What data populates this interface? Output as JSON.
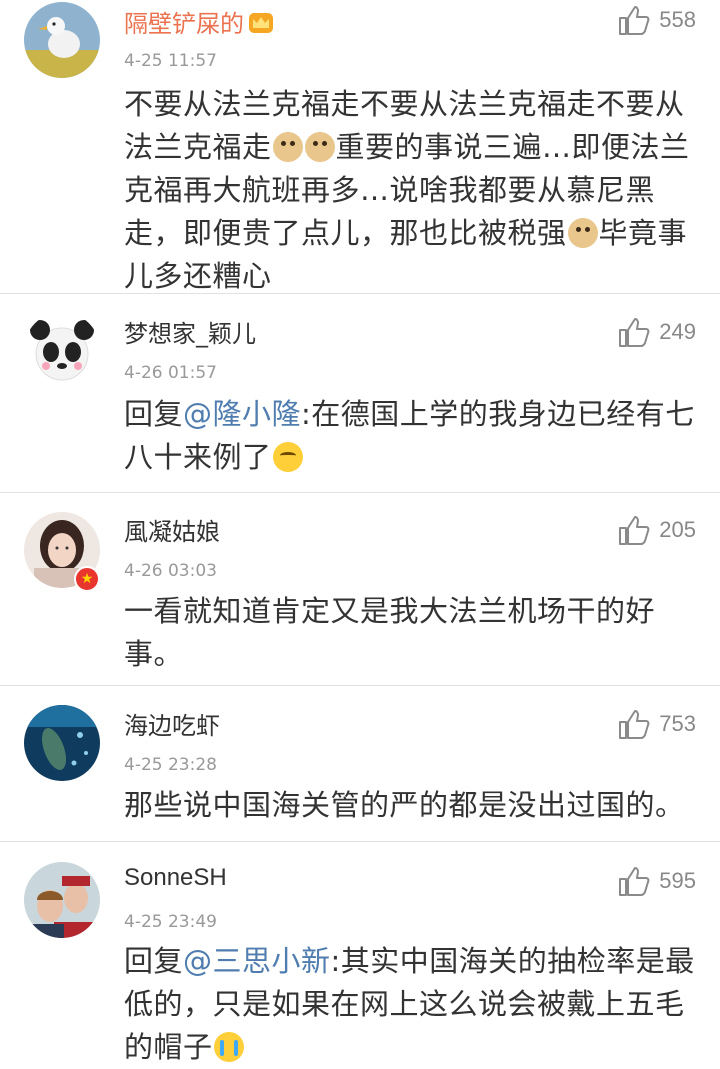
{
  "comments": [
    {
      "name": "隔壁铲屎的",
      "time": "4-25 11:57",
      "likes": "558",
      "text_parts": [
        "不要从法兰克福走不要从法兰克福走不要从法兰克福走",
        "重要的事说三遍…即便法兰克福再大航班再多…说啥我都要从慕尼黑走，即便贵了点儿，那也比被税强",
        "毕竟事儿多还糟心"
      ]
    },
    {
      "name": "梦想家_颖儿",
      "time": "4-26 01:57",
      "likes": "249",
      "reply_prefix": "回复",
      "mention": "@隆小隆",
      "text": ":在德国上学的我身边已经有七八十来例了"
    },
    {
      "name": "風凝姑娘",
      "time": "4-26 03:03",
      "likes": "205",
      "text": "一看就知道肯定又是我大法兰机场干的好事。"
    },
    {
      "name": "海边吃虾",
      "time": "4-25 23:28",
      "likes": "753",
      "text": "那些说中国海关管的严的都是没出过国的。"
    },
    {
      "name": "SonneSH",
      "time": "4-25 23:49",
      "likes": "595",
      "reply_prefix": "回复",
      "mention": "@三思小新",
      "text": ":其实中国海关的抽检率是最低的，只是如果在网上这么说会被戴上五毛的帽子"
    }
  ],
  "colors": {
    "vip_name": "#eb7350",
    "mention": "#507daf",
    "meta": "#999999"
  },
  "icons": [
    "thumbs-up-icon",
    "crown-icon",
    "doge-emoji",
    "thinking-emoji",
    "crying-emoji",
    "vip-badge-icon"
  ]
}
